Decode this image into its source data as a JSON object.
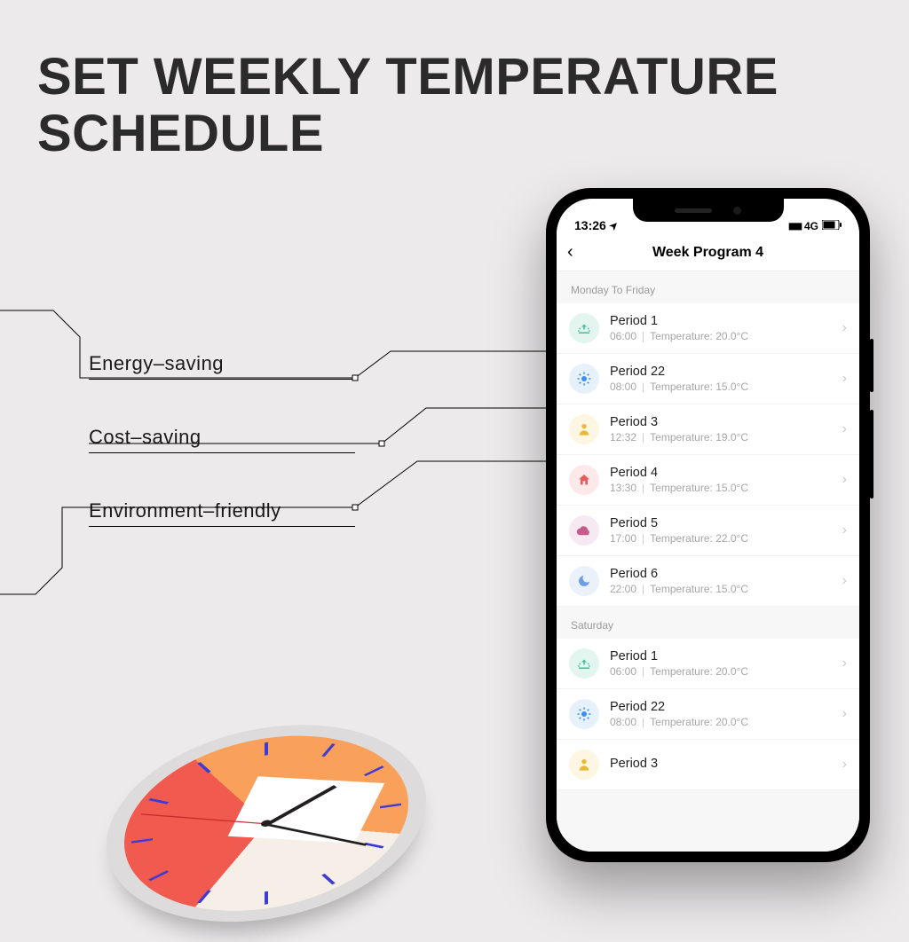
{
  "headline_line1": "SET WEEKLY TEMPERATURE",
  "headline_line2": "SCHEDULE",
  "features": [
    "Energy–saving",
    "Cost–saving",
    "Environment–friendly"
  ],
  "phone": {
    "status": {
      "time": "13:26",
      "network": "4G"
    },
    "nav": {
      "title": "Week Program 4",
      "back_glyph": "‹"
    },
    "sections": [
      {
        "header": "Monday To Friday",
        "rows": [
          {
            "icon": "sunrise",
            "title": "Period 1",
            "time": "06:00",
            "temp": "20.0°C"
          },
          {
            "icon": "sun",
            "title": "Period 22",
            "time": "08:00",
            "temp": "15.0°C"
          },
          {
            "icon": "person",
            "title": "Period 3",
            "time": "12:32",
            "temp": "19.0°C"
          },
          {
            "icon": "home",
            "title": "Period 4",
            "time": "13:30",
            "temp": "15.0°C"
          },
          {
            "icon": "cloud",
            "title": "Period 5",
            "time": "17:00",
            "temp": "22.0°C"
          },
          {
            "icon": "moon",
            "title": "Period 6",
            "time": "22:00",
            "temp": "15.0°C"
          }
        ]
      },
      {
        "header": "Saturday",
        "rows": [
          {
            "icon": "sunrise",
            "title": "Period 1",
            "time": "06:00",
            "temp": "20.0°C"
          },
          {
            "icon": "sun",
            "title": "Period 22",
            "time": "08:00",
            "temp": "20.0°C"
          },
          {
            "icon": "person",
            "title": "Period 3",
            "time": "",
            "temp": ""
          }
        ]
      }
    ],
    "temp_prefix": "Temperature: ",
    "chevron_glyph": "›"
  },
  "icon_glyphs": {
    "sunrise": "☼",
    "sun": "☀",
    "person": "👤",
    "home": "🏠",
    "cloud": "☁",
    "moon": "☾",
    "location_arrow": "➤",
    "signal": "▮▮▮▮",
    "battery": "▮▯"
  }
}
